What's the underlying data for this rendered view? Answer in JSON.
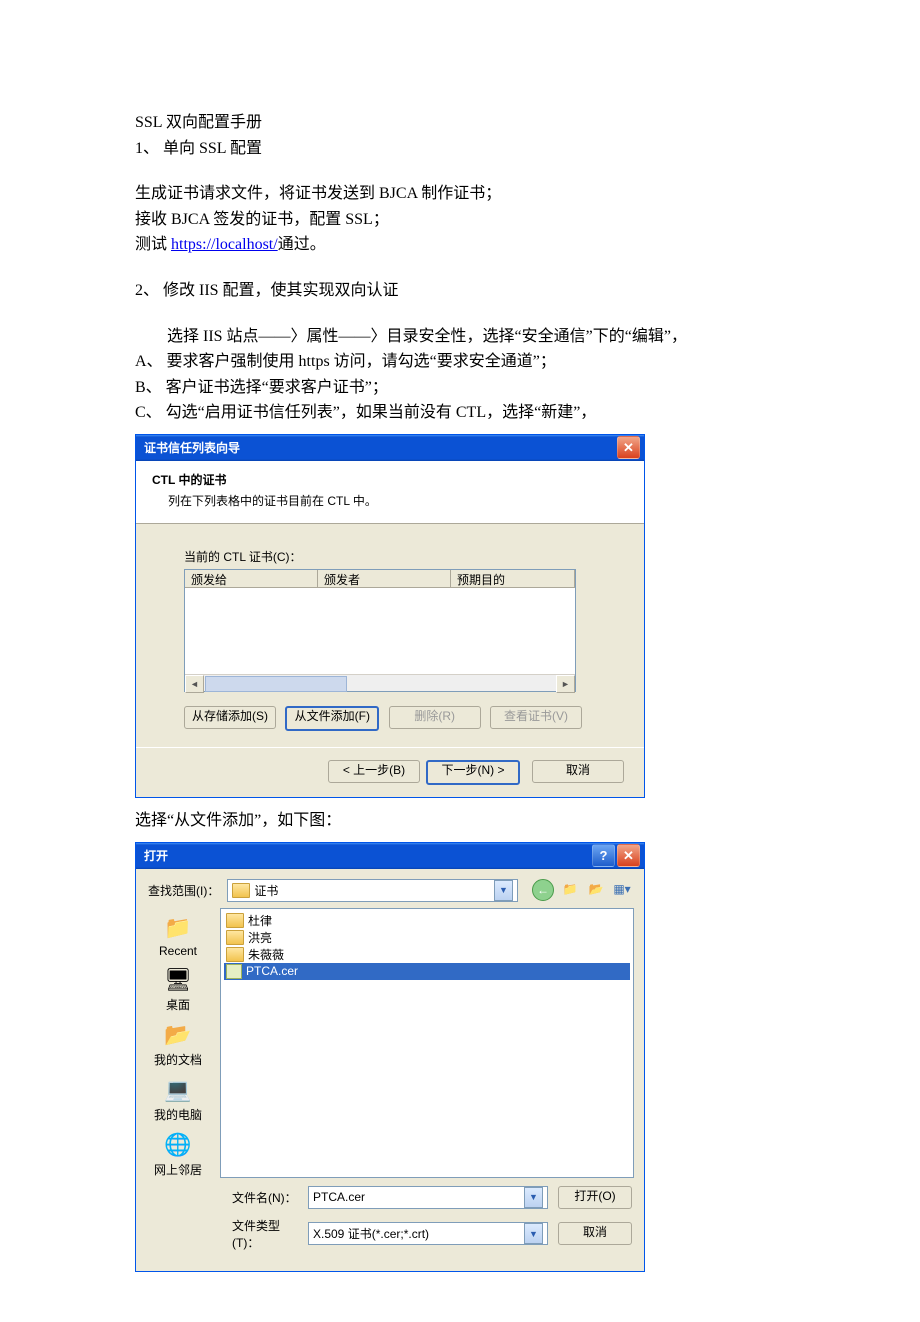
{
  "doc": {
    "title": "SSL 双向配置手册",
    "item1": "1、 单向 SSL 配置",
    "p1": "生成证书请求文件，将证书发送到 BJCA 制作证书；",
    "p2": "接收 BJCA 签发的证书，配置 SSL；",
    "p3_pre": "测试 ",
    "link": "https://localhost/",
    "p3_post": "通过。",
    "item2": "2、 修改 IIS 配置，使其实现双向认证",
    "step_intro": "　　选择 IIS 站点——〉属性——〉目录安全性，选择“安全通信”下的“编辑”，",
    "stepA": "A、 要求客户强制使用 https 访问，请勾选“要求安全通道”；",
    "stepB": "B、 客户证书选择“要求客户证书”；",
    "stepC": "C、 勾选“启用证书信任列表”，如果当前没有 CTL，选择“新建”，",
    "between": "选择“从文件添加”，如下图："
  },
  "wiz1": {
    "title": "证书信任列表向导",
    "header_bold": "CTL 中的证书",
    "header_sub": "列在下列表格中的证书目前在 CTL 中。",
    "list_label": "当前的 CTL 证书(C)：",
    "col1": "颁发给",
    "col2": "颁发者",
    "col3": "预期目的",
    "btn_from_store": "从存储添加(S)",
    "btn_from_file": "从文件添加(F)",
    "btn_remove": "删除(R)",
    "btn_view_cert": "查看证书(V)",
    "btn_back": "< 上一步(B)",
    "btn_next": "下一步(N) >",
    "btn_cancel": "取消"
  },
  "open": {
    "title": "打开",
    "look_in_label": "查找范围(I)：",
    "look_in_value": "证书",
    "places": {
      "recent": "Recent",
      "desktop": "桌面",
      "mydocs": "我的文档",
      "mycomp": "我的电脑",
      "network": "网上邻居"
    },
    "files": {
      "f1": "杜律",
      "f2": "洪亮",
      "f3": "朱薇薇",
      "f4": "PTCA.cer"
    },
    "filename_label": "文件名(N)：",
    "filename_value": "PTCA.cer",
    "filetype_label": "文件类型(T)：",
    "filetype_value": "X.509 证书(*.cer;*.crt)",
    "btn_open": "打开(O)",
    "btn_cancel": "取消"
  }
}
